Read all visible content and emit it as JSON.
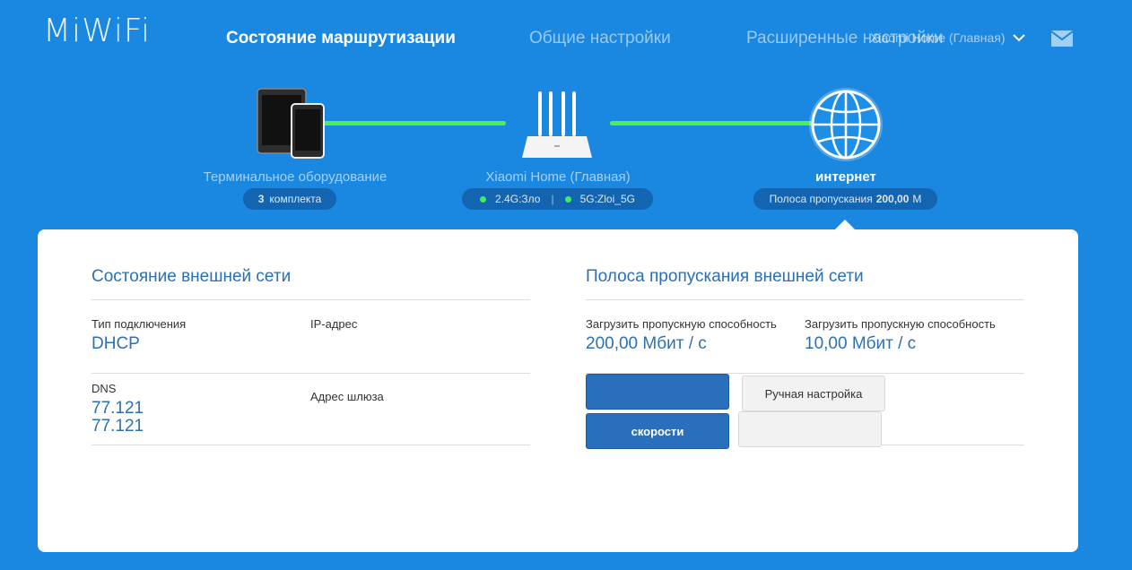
{
  "header": {
    "logo": "MiWiFi",
    "tabs": [
      {
        "label": "Состояние маршрутизации",
        "active": true
      },
      {
        "label": "Общие настройки",
        "active": false
      },
      {
        "label": "Расширенные настройки",
        "active": false
      }
    ],
    "router_name": "Xiaomi Home (Главная)",
    "mail_icon": "mail-icon"
  },
  "topology": {
    "devices": {
      "label": "Терминальное оборудование",
      "count": "3",
      "count_suffix": "комплекта"
    },
    "router": {
      "label": "Xiaomi Home (Главная)",
      "wifi_24": "2.4G:Зло",
      "wifi_5": "5G:Zloi_5G"
    },
    "internet": {
      "label": "интернет",
      "bandwidth_prefix": "Полоса пропускания",
      "bandwidth_value": "200,00",
      "bandwidth_unit": "М"
    },
    "link_color": "#4cf055"
  },
  "wan_status": {
    "title": "Состояние внешней сети",
    "connection_type_label": "Тип подключения",
    "connection_type_value": "DHCP",
    "ip_label": "IP-адрес",
    "ip_value": "",
    "dns_label": "DNS",
    "dns_values": [
      "77.121",
      "77.121"
    ],
    "gateway_label": "Адрес шлюза",
    "gateway_value": ""
  },
  "bandwidth": {
    "title": "Полоса пропускания внешней сети",
    "download_label": "Загрузить пропускную способность",
    "download_value": "200,00 Мбит / с",
    "upload_label": "Загрузить пропускную способность",
    "upload_value": "10,00 Мбит / с",
    "btn_blank": "",
    "btn_manual": "Ручная настройка",
    "btn_speed": "скорости",
    "btn_blank2": ""
  },
  "colors": {
    "background": "#1a87e0",
    "accent_text": "#2c6fb4",
    "button_blue": "#2a6fbb"
  }
}
